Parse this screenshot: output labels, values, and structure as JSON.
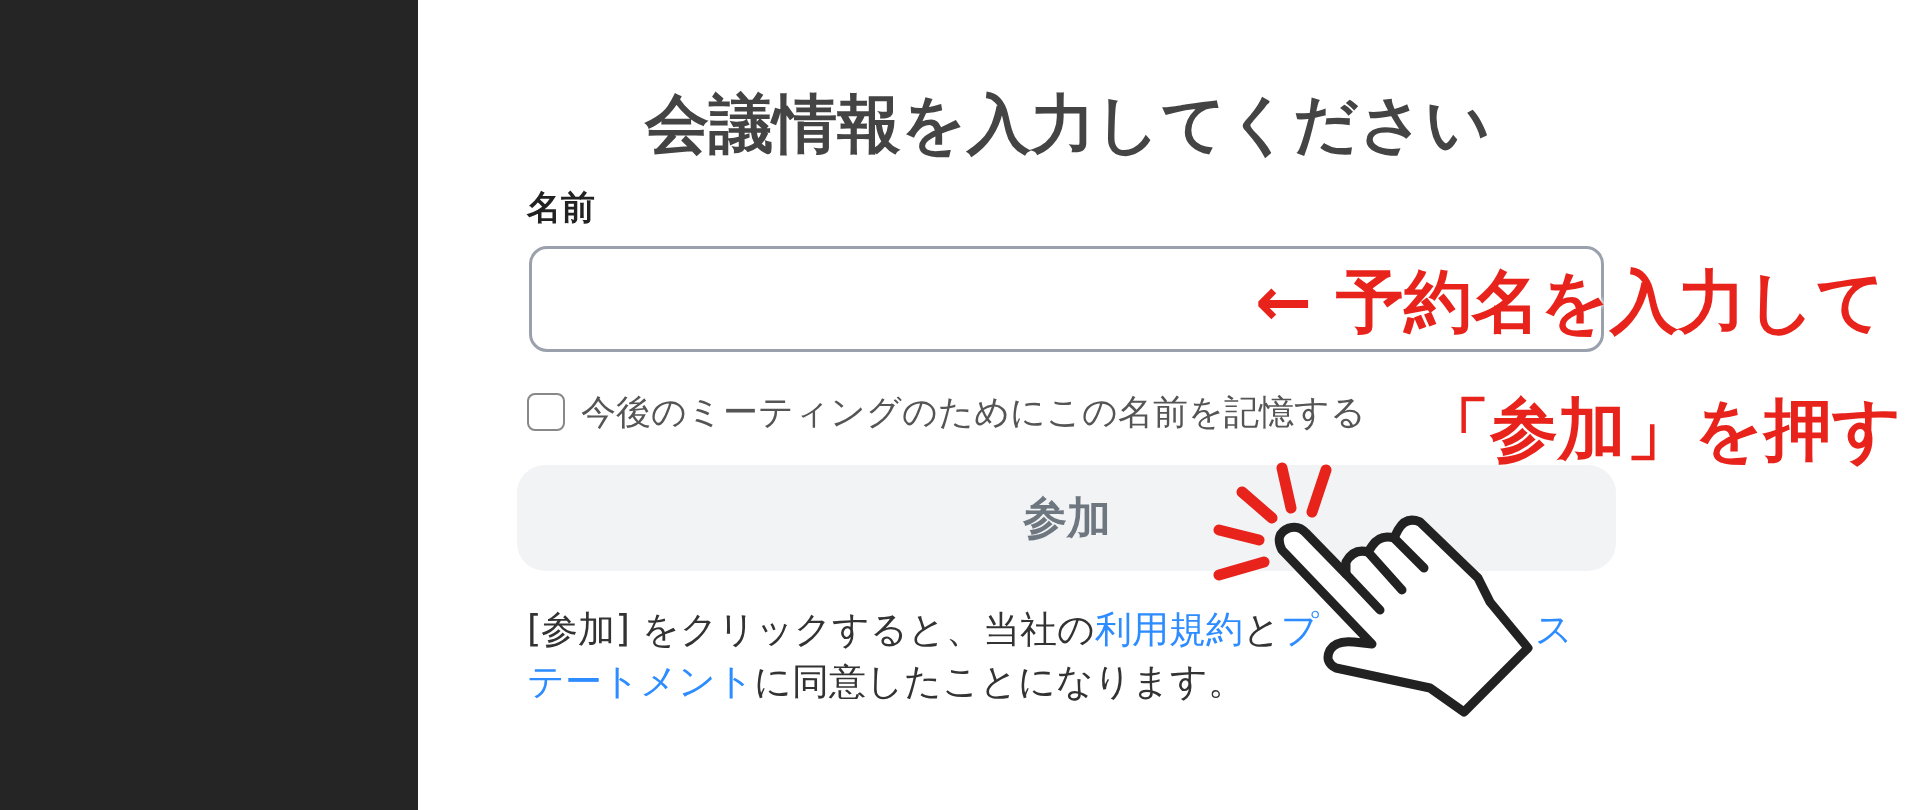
{
  "title": "会議情報を入力してください",
  "name_field": {
    "label": "名前"
  },
  "remember": {
    "label": "今後のミーティングのためにこの名前を記憶する",
    "checked": false
  },
  "join_button": "参加",
  "terms": [
    {
      "left": [
        {
          "text": "[参加] をクリックすると、当社の",
          "link": false
        },
        {
          "text": "利用規約",
          "link": true
        },
        {
          "text": "と",
          "link": false
        },
        {
          "text": "プ",
          "link": true
        }
      ],
      "right": [
        {
          "text": "ス",
          "link": true
        }
      ]
    },
    {
      "left": [
        {
          "text": "テートメント",
          "link": true
        },
        {
          "text": "に同意したことになります。",
          "link": false
        }
      ]
    }
  ],
  "annotations": [
    "← 予約名を入力して",
    "「参加」を押す"
  ]
}
